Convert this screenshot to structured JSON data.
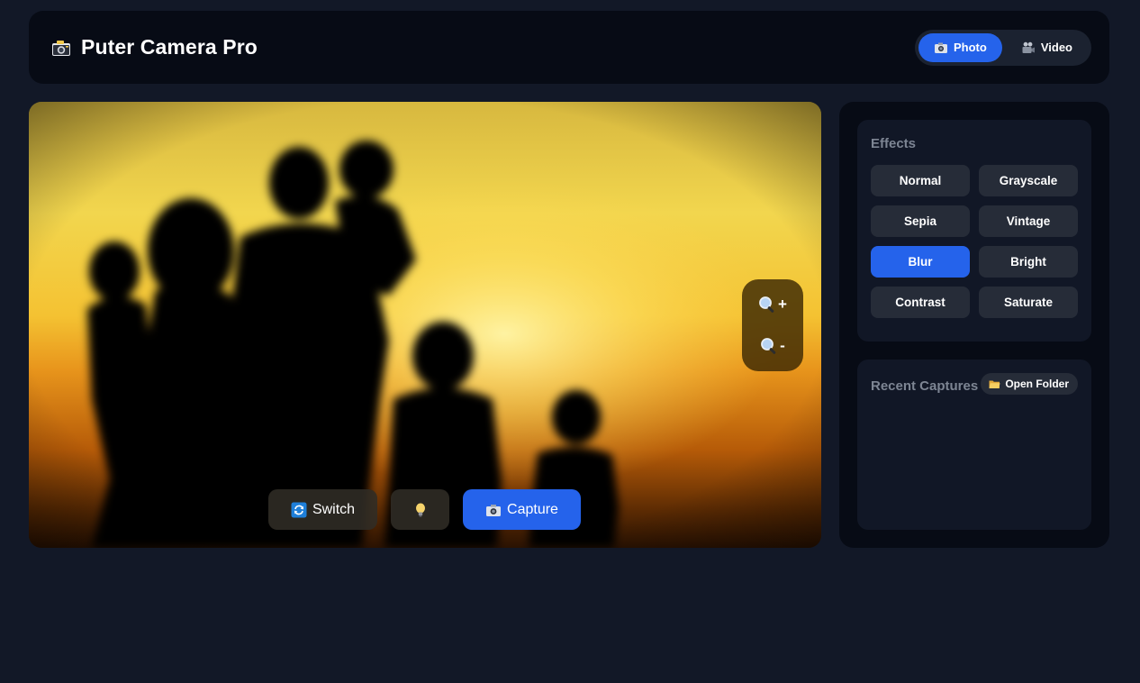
{
  "header": {
    "icon": "camera-icon",
    "title": "Puter Camera Pro",
    "modes": [
      {
        "label": "Photo",
        "icon": "camera-icon",
        "active": true
      },
      {
        "label": "Video",
        "icon": "video-camera-icon",
        "active": false
      }
    ]
  },
  "viewfinder": {
    "zoom": {
      "in_label": "+",
      "out_label": "-"
    },
    "controls": {
      "switch_label": "Switch",
      "flash_icon": "lightbulb-icon",
      "capture_label": "Capture"
    }
  },
  "sidebar": {
    "effects": {
      "title": "Effects",
      "items": [
        "Normal",
        "Grayscale",
        "Sepia",
        "Vintage",
        "Blur",
        "Bright",
        "Contrast",
        "Saturate"
      ],
      "active": "Blur"
    },
    "captures": {
      "title": "Recent Captures",
      "open_folder_label": "Open Folder",
      "items": []
    }
  },
  "colors": {
    "background": "#121827",
    "panel": "#070b15",
    "card": "#111726",
    "button": "#262c38",
    "accent": "#2563eb"
  }
}
